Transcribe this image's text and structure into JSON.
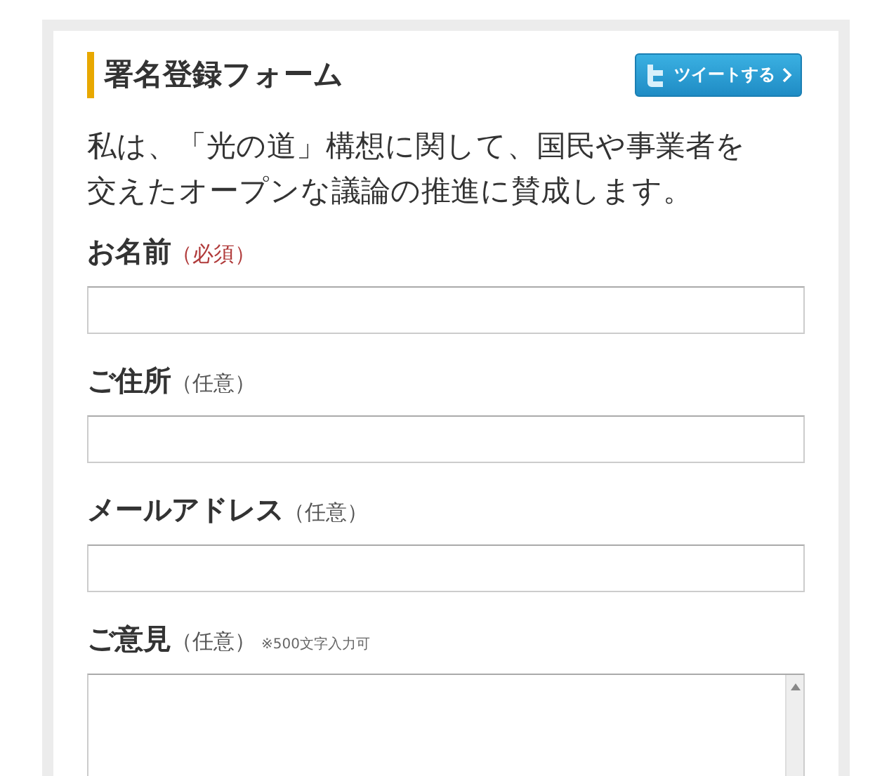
{
  "form": {
    "title": "署名登録フォーム",
    "tweet_button": {
      "label": "ツイートする"
    },
    "statement": "私は、「光の道」構想に関して、国民や事業者を交えたオープンな議論の推進に賛成します。",
    "fields": [
      {
        "label": "お名前",
        "note": "（必須）",
        "required": true,
        "kind": "text"
      },
      {
        "label": "ご住所",
        "note": "（任意）",
        "required": false,
        "kind": "text"
      },
      {
        "label": "メールアドレス",
        "note": "（任意）",
        "required": false,
        "kind": "text"
      },
      {
        "label": "ご意見",
        "note": "（任意）",
        "required": false,
        "kind": "textarea",
        "hint": "※500文字入力可"
      }
    ]
  }
}
